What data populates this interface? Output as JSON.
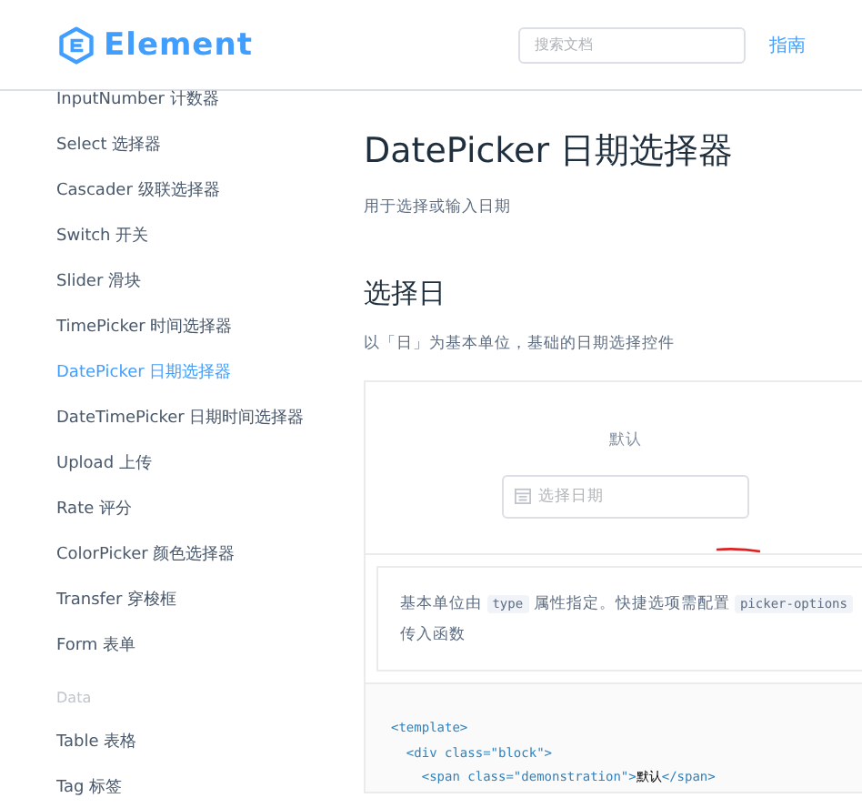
{
  "header": {
    "logo": "Element",
    "search": {
      "placeholder": "搜索文档"
    },
    "nav": [
      {
        "label": "指南",
        "selected": false
      }
    ]
  },
  "sidebar": {
    "items": [
      {
        "kind": "link",
        "label": "InputNumber 计数器",
        "selected": false
      },
      {
        "kind": "link",
        "label": "Select 选择器",
        "selected": false
      },
      {
        "kind": "link",
        "label": "Cascader 级联选择器",
        "selected": false
      },
      {
        "kind": "link",
        "label": "Switch 开关",
        "selected": false
      },
      {
        "kind": "link",
        "label": "Slider 滑块",
        "selected": false
      },
      {
        "kind": "link",
        "label": "TimePicker 时间选择器",
        "selected": false
      },
      {
        "kind": "link",
        "label": "DatePicker 日期选择器",
        "selected": true
      },
      {
        "kind": "link",
        "label": "DateTimePicker 日期时间选择器",
        "selected": false
      },
      {
        "kind": "link",
        "label": "Upload 上传",
        "selected": false
      },
      {
        "kind": "link",
        "label": "Rate 评分",
        "selected": false
      },
      {
        "kind": "link",
        "label": "ColorPicker 颜色选择器",
        "selected": false
      },
      {
        "kind": "link",
        "label": "Transfer 穿梭框",
        "selected": false
      },
      {
        "kind": "link",
        "label": "Form 表单",
        "selected": false
      },
      {
        "kind": "group",
        "label": "Data"
      },
      {
        "kind": "link",
        "label": "Table 表格",
        "selected": false
      },
      {
        "kind": "link",
        "label": "Tag 标签",
        "selected": false
      }
    ]
  },
  "main": {
    "title": "DatePicker 日期选择器",
    "subtitle": "用于选择或输入日期",
    "section_title": "选择日",
    "section_desc": "以「日」为基本单位，基础的日期选择控件",
    "demo": {
      "label": "默认",
      "input": {
        "placeholder": "选择日期"
      }
    },
    "description": [
      [
        {
          "kind": "text",
          "text": "基本单位由 "
        },
        {
          "kind": "code",
          "text": "type"
        },
        {
          "kind": "text",
          "text": " 属性指定。快捷选项需配置 "
        },
        {
          "kind": "code",
          "text": "picker-options"
        }
      ],
      [
        {
          "kind": "text",
          "text": "传入函数"
        }
      ]
    ],
    "code": [
      [
        {
          "kind": "tag",
          "text": "<template>"
        }
      ],
      [
        {
          "kind": "tag",
          "text": "  <div class=\"block\">"
        }
      ],
      [
        {
          "kind": "tag",
          "text": "    <span class=\"demonstration\">"
        },
        {
          "kind": "text",
          "text": "默认"
        },
        {
          "kind": "tag",
          "text": "</span>"
        }
      ]
    ]
  }
}
